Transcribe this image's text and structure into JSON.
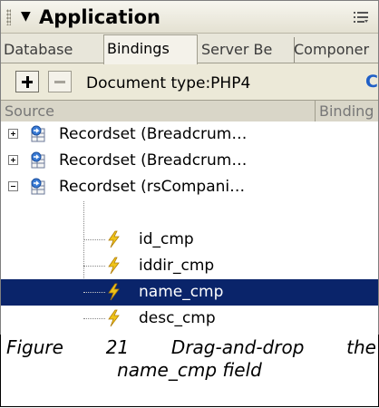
{
  "panel": {
    "title": "Application",
    "tabs": [
      "Database",
      "Bindings",
      "Server Be",
      "Componer"
    ],
    "active_tab": "Bindings",
    "toolbar": {
      "add_label": "+",
      "remove_label": "−",
      "document_type": "Document type:PHP4"
    },
    "columns": [
      "Source",
      "Binding"
    ],
    "tree": [
      {
        "label": "Recordset (Breadcrum…",
        "expander": "plus"
      },
      {
        "label": "Recordset (Breadcrum…",
        "expander": "plus"
      },
      {
        "label": "Recordset (rsCompani…",
        "expander": "minus"
      }
    ],
    "fields": [
      "id_cmp",
      "iddir_cmp",
      "name_cmp",
      "desc_cmp"
    ],
    "selected_field": "name_cmp"
  },
  "caption": {
    "words": [
      "Figure",
      "21",
      "Drag-and-drop",
      "the"
    ],
    "line2": "name_cmp field"
  },
  "colors": {
    "selection": "#0a246a",
    "panel_bg": "#ece9d8",
    "bolt": "#f0c419",
    "refresh": "#1f5fc7"
  }
}
